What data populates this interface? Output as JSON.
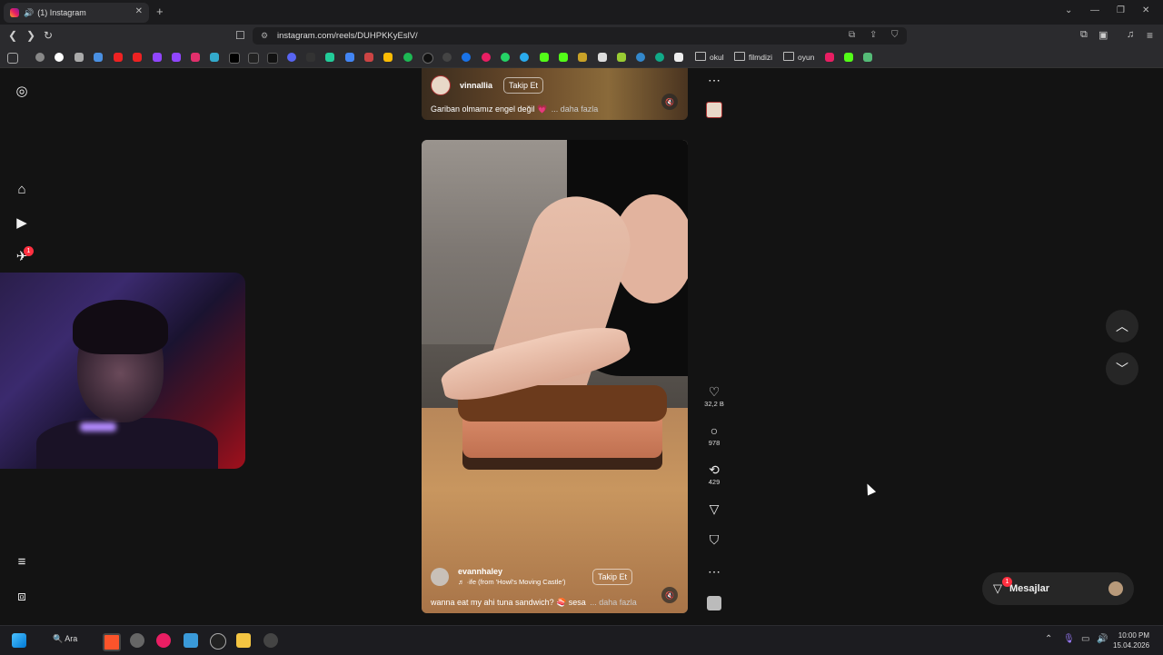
{
  "browser": {
    "tab_title": "(1) Instagram",
    "url": "instagram.com/reels/DUHPKKyEslV/",
    "bookmark_folders": [
      "okul",
      "filmdizi",
      "oyun"
    ]
  },
  "sidebar": {
    "notification_badge": "1"
  },
  "reels": {
    "top": {
      "username": "vinnallia",
      "follow_label": "Takip Et",
      "caption": "Gariban olmamız engel değil 💗",
      "more_label": "... daha fazla"
    },
    "main": {
      "username": "evannhaley",
      "follow_label": "Takip Et",
      "audio": "·ife (from 'Howl's Moving Castle')",
      "caption": "wanna eat my ahi tuna sandwich? 🍣 sesa",
      "more_label": "... daha fazla"
    }
  },
  "actions": {
    "likes": "32,2 B",
    "comments": "978",
    "reposts": "429"
  },
  "messages": {
    "label": "Mesajlar",
    "badge": "1"
  },
  "taskbar": {
    "search_label": "Ara",
    "time": "10:00 PM",
    "date": "15.04.2026"
  }
}
